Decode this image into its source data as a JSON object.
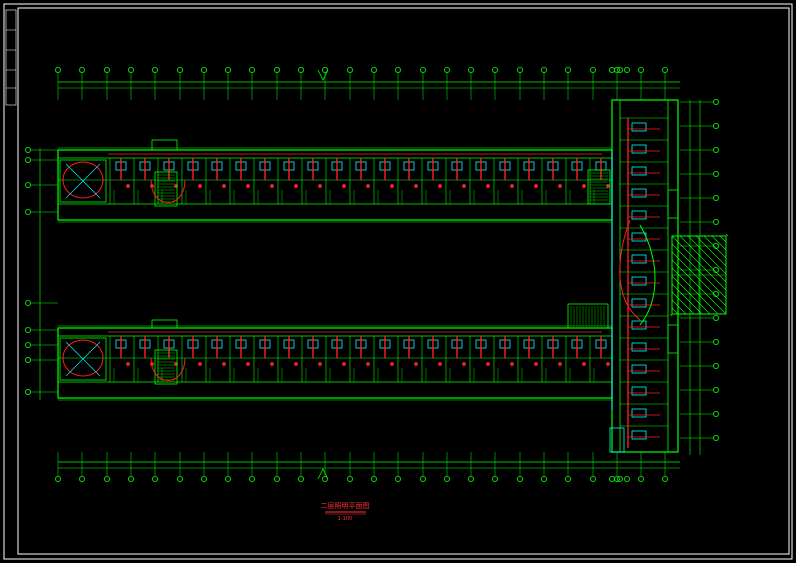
{
  "drawing": {
    "title": "二层照明平面图",
    "scale": "1:100"
  },
  "colors": {
    "background": "#000000",
    "border": "#ffffff",
    "wall": "#00ff00",
    "circuit": "#ff2020",
    "fixture": "#00ffff",
    "grid": "#00ff00",
    "text": "#ff3030"
  }
}
